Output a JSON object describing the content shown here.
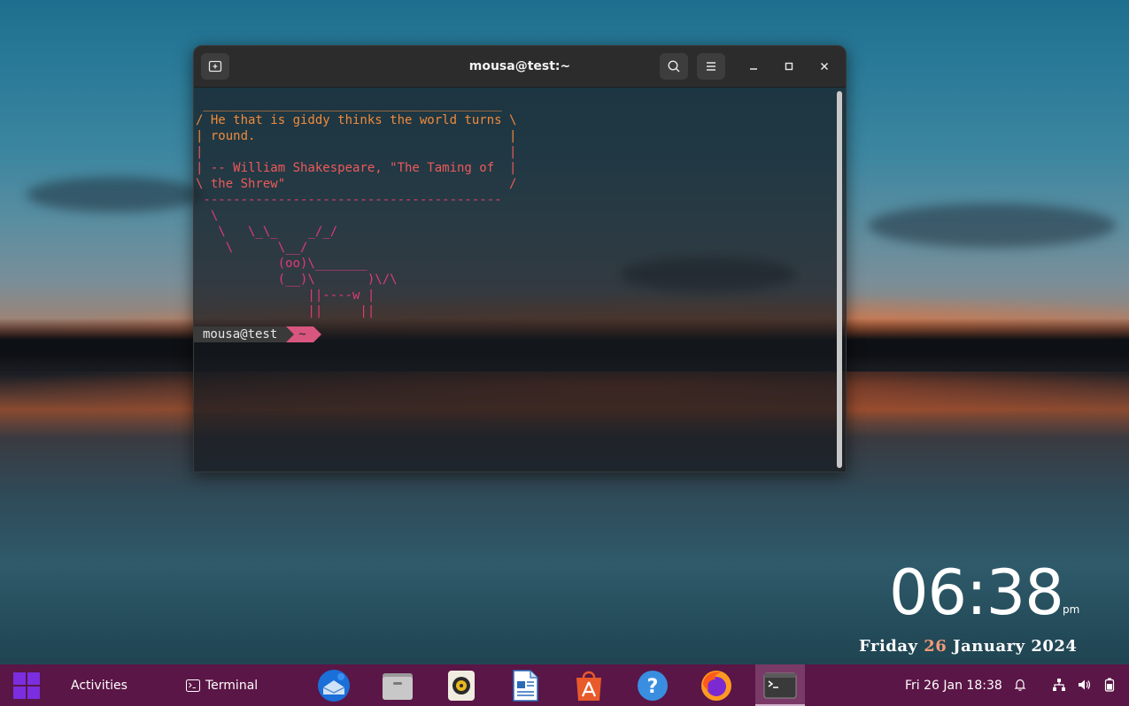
{
  "terminal": {
    "title": "mousa@test:~",
    "fortune_lines": [
      " ________________________________________",
      "/ He that is giddy thinks the world turns \\",
      "| round.                                  |",
      "|                                         |",
      "| -- William Shakespeare, \"The Taming of  |",
      "\\ the Shrew\"                              /",
      " ----------------------------------------"
    ],
    "cow_lines": [
      "  \\",
      "   \\   \\_\\_    _/_/",
      "    \\      \\__/",
      "           (oo)\\_______",
      "           (__)\\       )\\/\\",
      "               ||----w |",
      "               ||     ||"
    ],
    "prompt": {
      "user": "mousa@test",
      "dir": "~"
    }
  },
  "clock": {
    "time": "06:38",
    "ampm": "pm",
    "weekday": "Friday",
    "day": "26",
    "month_year": "January 2024"
  },
  "taskbar": {
    "activities": "Activities",
    "active_app": "Terminal",
    "datetime": "Fri 26 Jan  18:38",
    "apps": [
      "thunderbird-icon",
      "files-icon",
      "rhythmbox-icon",
      "libreoffice-writer-icon",
      "app-center-icon",
      "help-icon",
      "firefox-icon",
      "terminal-icon"
    ]
  },
  "colors": {
    "taskbar_bg": "#5a1646",
    "prompt_dir_bg": "#d9567f",
    "clock_day": "#f29a7a"
  }
}
